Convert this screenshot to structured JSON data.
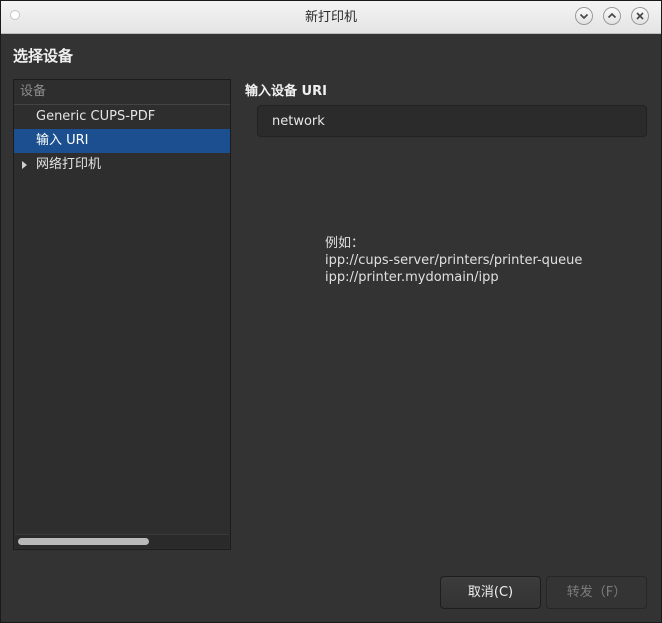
{
  "window": {
    "title": "新打印机"
  },
  "section": {
    "title": "选择设备"
  },
  "devices": {
    "header": "设备",
    "items": [
      {
        "label": "Generic CUPS-PDF"
      },
      {
        "label": "输入 URI"
      },
      {
        "label": "网络打印机"
      }
    ]
  },
  "uri": {
    "label": "输入设备 URI",
    "value": "network"
  },
  "example": {
    "heading": "例如：",
    "lines": [
      "ipp://cups-server/printers/printer-queue",
      "ipp://printer.mydomain/ipp"
    ]
  },
  "buttons": {
    "cancel": "取消(C)",
    "forward": "转发（F）"
  },
  "colors": {
    "selection": "#1b4f8f",
    "background": "#333333"
  }
}
